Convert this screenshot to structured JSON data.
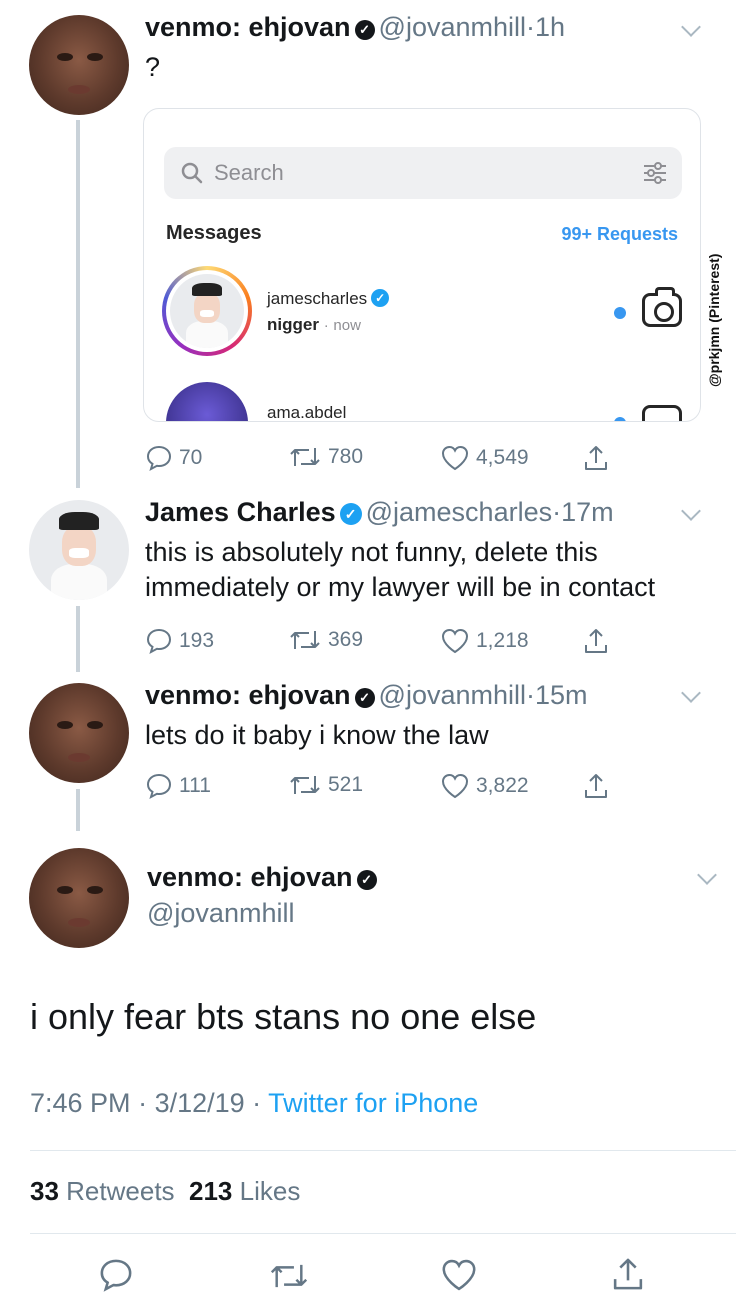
{
  "tweets": [
    {
      "display_name": "venmo: ehjovan",
      "handle": "@jovanmhill",
      "time": "1h",
      "text": "?",
      "replies": "70",
      "retweets": "780",
      "likes": "4,549"
    },
    {
      "display_name": "James Charles",
      "handle": "@jamescharles",
      "time": "17m",
      "text_line1": "this is absolutely not funny, delete this",
      "text_line2": "immediately or my lawyer will be in contact",
      "replies": "193",
      "retweets": "369",
      "likes": "1,218"
    },
    {
      "display_name": "venmo: ehjovan",
      "handle": "@jovanmhill",
      "time": "15m",
      "text": "lets do it baby i know the law",
      "replies": "111",
      "retweets": "521",
      "likes": "3,822"
    }
  ],
  "embedded_screenshot": {
    "search_placeholder": "Search",
    "messages_label": "Messages",
    "requests_label": "99+ Requests",
    "conversations": [
      {
        "username": "jamescharles",
        "last_message": "nigger",
        "time": "now"
      },
      {
        "username": "ama.abdel"
      }
    ]
  },
  "watermark": "@prkjmn (Pinterest)",
  "main_tweet": {
    "display_name": "venmo: ehjovan",
    "handle": "@jovanmhill",
    "text": "i only fear bts stans no one else",
    "time": "7:46 PM",
    "date": "3/12/19",
    "client": "Twitter for iPhone",
    "retweets_count": "33",
    "retweets_label": "Retweets",
    "likes_count": "213",
    "likes_label": "Likes"
  },
  "separators": {
    "dot": "·",
    "dot_spaced": " · "
  },
  "colors": {
    "accent": "#1da1f2",
    "text_primary": "#14171a",
    "text_secondary": "#657786",
    "thread_line": "#c9d2d9"
  },
  "icons": [
    "verified-badge-icon",
    "chevron-down-icon",
    "reply-icon",
    "retweet-icon",
    "like-icon",
    "share-icon",
    "search-icon",
    "filter-icon",
    "camera-icon"
  ]
}
